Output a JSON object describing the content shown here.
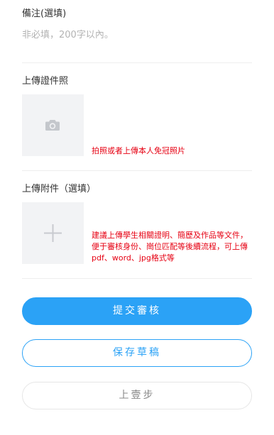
{
  "remark": {
    "label": "備注(選填)",
    "placeholder": "非必填，200字以內。"
  },
  "id_photo": {
    "label": "上傳證件照",
    "hint": "拍照或者上傳本人免冠照片",
    "icon": "camera-icon"
  },
  "attachment": {
    "label": "上傳附件（選填）",
    "hint": "建議上傳學生相關證明、簡歷及作品等文件，便于審核身份、崗位匹配等後續流程，可上傳pdf、word、jpg格式等",
    "icon": "plus-icon"
  },
  "actions": {
    "submit_label": "提交審核",
    "save_label": "保存草稿",
    "back_label": "上壹步"
  },
  "colors": {
    "accent": "#2ba2f6",
    "hint": "#e60012",
    "placeholder": "#b3b3b3",
    "upload_bg": "#f2f3f5"
  }
}
